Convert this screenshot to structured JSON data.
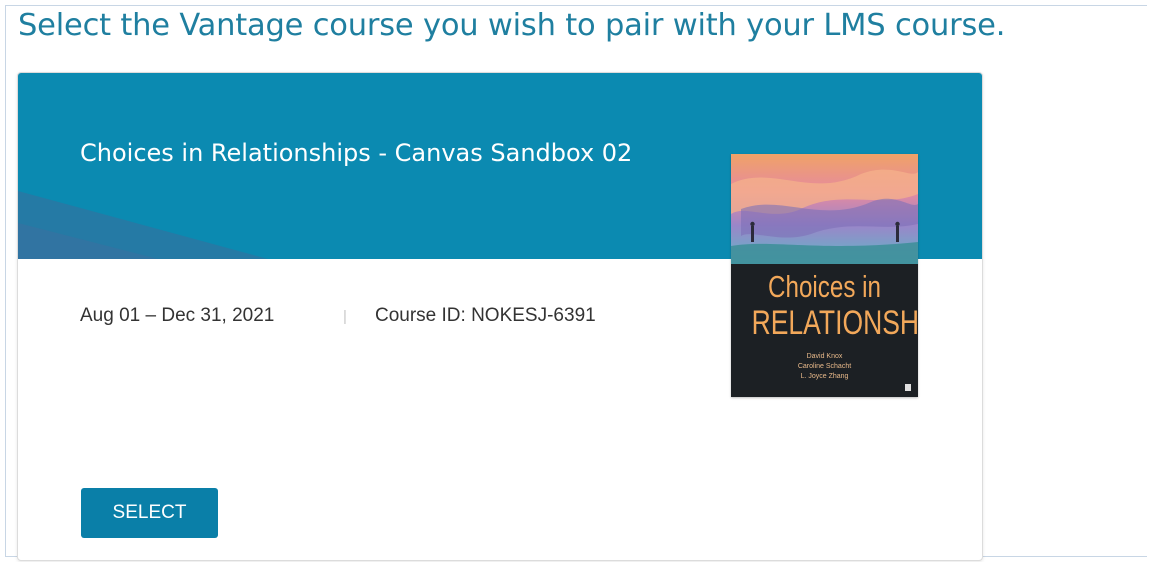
{
  "page": {
    "heading": "Select the Vantage course you wish to pair with your LMS course."
  },
  "course": {
    "title": "Choices in Relationships - Canvas Sandbox 02",
    "dates": "Aug 01 – Dec 31, 2021",
    "separator": "|",
    "course_id": "Course ID: NOKESJ-6391",
    "select_label": "SELECT",
    "cover": {
      "title_line1": "Choices in",
      "title_line2": "RELATIONSHIPS",
      "authors": [
        "David Knox",
        "Caroline Schacht",
        "L. Joyce Zhang"
      ]
    }
  },
  "colors": {
    "heading": "#1f7fa0",
    "banner": "#0b8ab1",
    "button": "#0a7fa8",
    "cover_title": "#f2a85a"
  }
}
